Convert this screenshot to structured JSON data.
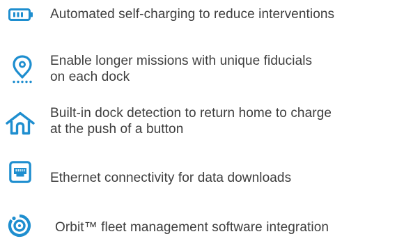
{
  "accent_color": "#1e8ecf",
  "text_color": "#3d3d3d",
  "features": [
    {
      "icon": "battery-icon",
      "lines": [
        "Automated self-charging to reduce interventions"
      ]
    },
    {
      "icon": "location-pin-icon",
      "lines": [
        "Enable longer missions with unique fiducials",
        "on each dock"
      ]
    },
    {
      "icon": "home-icon",
      "lines": [
        "Built-in dock detection to return home to charge",
        "at the push of a button"
      ]
    },
    {
      "icon": "ethernet-port-icon",
      "lines": [
        "Ethernet connectivity for data downloads"
      ]
    },
    {
      "icon": "orbit-icon",
      "lines": [
        "Orbit™ fleet management software integration"
      ]
    }
  ]
}
